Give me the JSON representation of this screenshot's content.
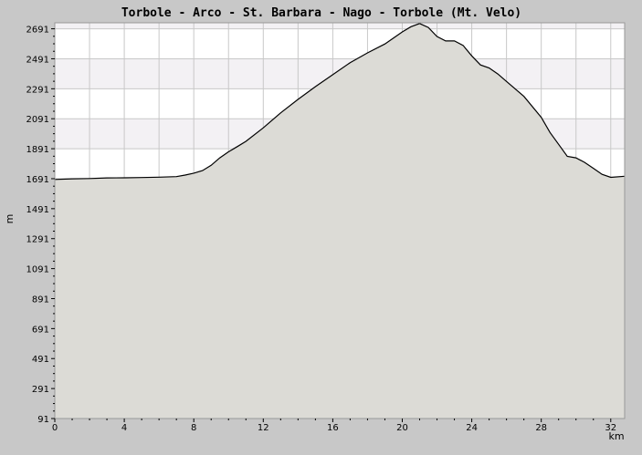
{
  "chart_data": {
    "type": "area",
    "title": "Torbole - Arco - St. Barbara - Nago - Torbole (Mt. Velo)",
    "xlabel": "km",
    "ylabel": "m",
    "xlim": [
      0,
      32.8
    ],
    "ylim": [
      91,
      2731
    ],
    "x_ticks": [
      "0",
      "4",
      "8",
      "12",
      "16",
      "20",
      "24",
      "28",
      "32"
    ],
    "y_ticks": [
      "91",
      "291",
      "491",
      "691",
      "891",
      "1091",
      "1291",
      "1491",
      "1691",
      "1891",
      "2091",
      "2291",
      "2491",
      "2691"
    ],
    "grid": true,
    "colors": {
      "background": "#c8c8c8",
      "plot_bg": "#ffffff",
      "band": "#f3f1f4",
      "area_fill": "#dcdbd6",
      "line": "#000000",
      "grid": "#c8c8c8"
    },
    "series": [
      {
        "x": [
          0,
          1,
          2,
          3,
          4,
          5,
          6,
          7,
          7.5,
          8,
          8.5,
          9,
          9.5,
          10,
          10.5,
          11,
          12,
          13,
          14,
          15,
          16,
          17,
          18,
          19,
          19.5,
          20,
          20.5,
          21,
          21.5,
          22,
          22.5,
          23,
          23.5,
          24,
          24.5,
          25,
          25.5,
          26,
          27,
          28,
          28.5,
          29,
          29.5,
          30,
          30.5,
          31,
          31.5,
          32,
          32.8
        ],
        "y": [
          1686,
          1690,
          1692,
          1696,
          1697,
          1699,
          1701,
          1705,
          1715,
          1728,
          1745,
          1780,
          1830,
          1870,
          1905,
          1940,
          2030,
          2130,
          2220,
          2305,
          2385,
          2465,
          2530,
          2590,
          2630,
          2670,
          2705,
          2726,
          2700,
          2640,
          2610,
          2610,
          2580,
          2510,
          2450,
          2430,
          2390,
          2340,
          2240,
          2100,
          2000,
          1920,
          1840,
          1830,
          1800,
          1760,
          1720,
          1700,
          1707
        ]
      }
    ]
  }
}
